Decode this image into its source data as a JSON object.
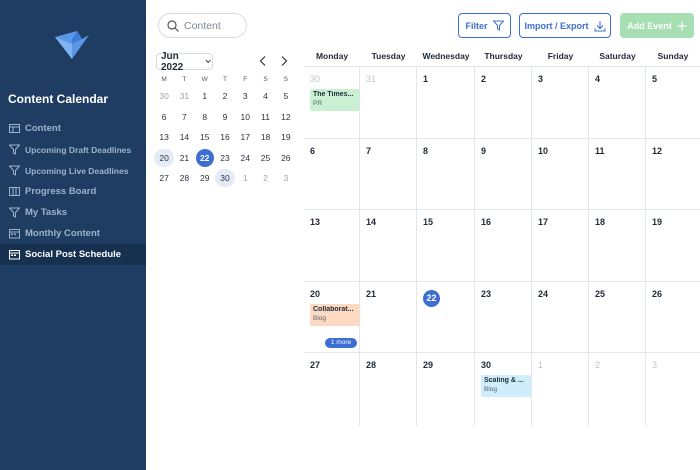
{
  "sidebar": {
    "app_title": "Content Calendar",
    "items": [
      {
        "label": "Content",
        "icon": "table-icon",
        "size": "normal",
        "active": false
      },
      {
        "label": "Upcoming Draft Deadlines",
        "icon": "filter-icon",
        "size": "small",
        "active": false
      },
      {
        "label": "Upcoming Live Deadlines",
        "icon": "filter-icon",
        "size": "small",
        "active": false
      },
      {
        "label": "Progress Board",
        "icon": "board-icon",
        "size": "normal",
        "active": false
      },
      {
        "label": "My Tasks",
        "icon": "filter-icon",
        "size": "normal",
        "active": false
      },
      {
        "label": "Monthly Content",
        "icon": "calendar-icon",
        "size": "normal",
        "active": false
      },
      {
        "label": "Social Post Schedule",
        "icon": "calendar-icon",
        "size": "normal",
        "active": true
      }
    ]
  },
  "toolbar": {
    "search_placeholder": "Content",
    "filter_label": "Filter",
    "import_label": "Import / Export",
    "add_label": "Add Event"
  },
  "mini_calendar": {
    "month_label": "Jun 2022",
    "weekday_headers": [
      "M",
      "T",
      "W",
      "T",
      "F",
      "S",
      "S"
    ],
    "weeks": [
      [
        {
          "d": "30",
          "o": true
        },
        {
          "d": "31",
          "o": true
        },
        {
          "d": "1"
        },
        {
          "d": "2"
        },
        {
          "d": "3"
        },
        {
          "d": "4"
        },
        {
          "d": "5"
        }
      ],
      [
        {
          "d": "6"
        },
        {
          "d": "7"
        },
        {
          "d": "8"
        },
        {
          "d": "9"
        },
        {
          "d": "10"
        },
        {
          "d": "11"
        },
        {
          "d": "12"
        }
      ],
      [
        {
          "d": "13"
        },
        {
          "d": "14"
        },
        {
          "d": "15"
        },
        {
          "d": "16"
        },
        {
          "d": "17"
        },
        {
          "d": "18"
        },
        {
          "d": "19"
        }
      ],
      [
        {
          "d": "20",
          "w": true
        },
        {
          "d": "21"
        },
        {
          "d": "22",
          "t": true
        },
        {
          "d": "23"
        },
        {
          "d": "24"
        },
        {
          "d": "25"
        },
        {
          "d": "26"
        }
      ],
      [
        {
          "d": "27"
        },
        {
          "d": "28"
        },
        {
          "d": "29"
        },
        {
          "d": "30",
          "w": true
        },
        {
          "d": "1",
          "o": true
        },
        {
          "d": "2",
          "o": true
        },
        {
          "d": "3",
          "o": true
        }
      ]
    ]
  },
  "month_view": {
    "day_headers": [
      "Monday",
      "Tuesday",
      "Wednesday",
      "Thursday",
      "Friday",
      "Saturday",
      "Sunday"
    ],
    "weeks": [
      [
        {
          "day": "30",
          "other": true,
          "events": [
            {
              "title": "The Times...",
              "category": "PR",
              "color": "green"
            }
          ]
        },
        {
          "day": "31",
          "other": true
        },
        {
          "day": "1"
        },
        {
          "day": "2"
        },
        {
          "day": "3"
        },
        {
          "day": "4"
        },
        {
          "day": "5"
        }
      ],
      [
        {
          "day": "6"
        },
        {
          "day": "7"
        },
        {
          "day": "8"
        },
        {
          "day": "9"
        },
        {
          "day": "10"
        },
        {
          "day": "11"
        },
        {
          "day": "12"
        }
      ],
      [
        {
          "day": "13"
        },
        {
          "day": "14"
        },
        {
          "day": "15"
        },
        {
          "day": "16"
        },
        {
          "day": "17"
        },
        {
          "day": "18"
        },
        {
          "day": "19"
        }
      ],
      [
        {
          "day": "20",
          "events": [
            {
              "title": "Collaborat...",
              "category": "Blog",
              "color": "orange"
            }
          ],
          "more": "1 more"
        },
        {
          "day": "21"
        },
        {
          "day": "22",
          "today": true
        },
        {
          "day": "23"
        },
        {
          "day": "24"
        },
        {
          "day": "25"
        },
        {
          "day": "26"
        }
      ],
      [
        {
          "day": "27"
        },
        {
          "day": "28"
        },
        {
          "day": "29"
        },
        {
          "day": "30",
          "events": [
            {
              "title": "Scaling & ...",
              "category": "Blog",
              "color": "blue"
            }
          ]
        },
        {
          "day": "1",
          "other": true
        },
        {
          "day": "2",
          "other": true
        },
        {
          "day": "3",
          "other": true
        }
      ]
    ]
  }
}
